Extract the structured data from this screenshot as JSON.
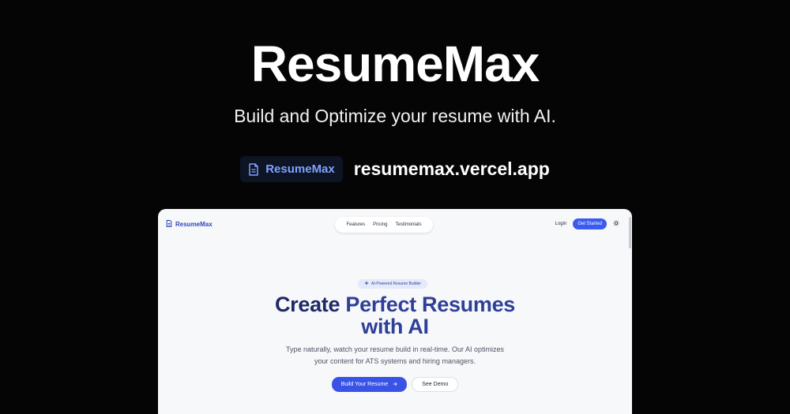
{
  "hero": {
    "title": "ResumeMax",
    "subtitle": "Build and Optimize your resume with AI."
  },
  "brand": {
    "chip_label": "ResumeMax",
    "url": "resumemax.vercel.app",
    "icon": "document-icon"
  },
  "preview": {
    "logo_label": "ResumeMax",
    "nav_links": [
      "Features",
      "Pricing",
      "Testimonials"
    ],
    "login_label": "Login",
    "get_started_label": "Get Started",
    "settings_icon": "sun-icon",
    "badge_label": "AI-Powered Resume Builder",
    "headline_line1_a": "Create ",
    "headline_line1_b": "Perfect Resumes",
    "headline_line2": "with AI",
    "description_line1": "Type naturally, watch your resume build in real-time. Our AI optimizes",
    "description_line2": "your content for ATS systems and hiring managers.",
    "primary_button": "Build Your Resume",
    "secondary_button": "See Demo"
  },
  "colors": {
    "background": "#050505",
    "accent": "#3b5bf0",
    "chip_text": "#7ea2ff",
    "headline": "#1e2a66"
  }
}
